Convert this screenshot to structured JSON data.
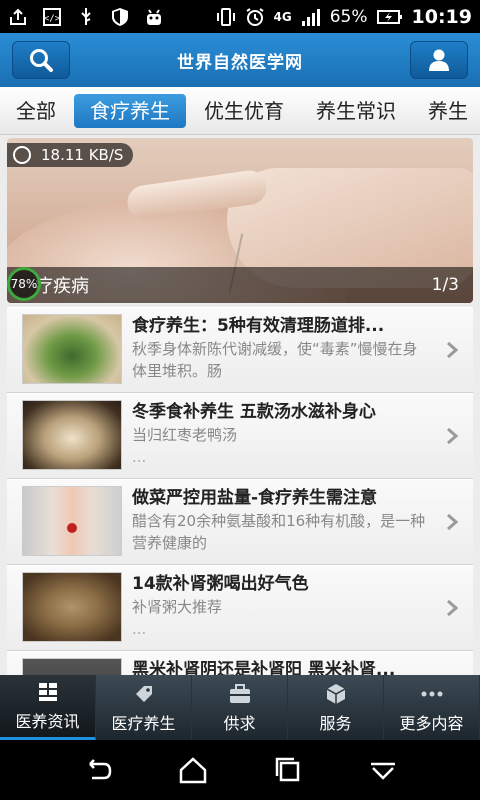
{
  "status_bar": {
    "battery_percent": "65%",
    "time": "10:19",
    "network": "4G"
  },
  "header": {
    "title": "世界自然医学网"
  },
  "tabs": [
    {
      "label": "全部",
      "active": false
    },
    {
      "label": "食疗养生",
      "active": true
    },
    {
      "label": "优生优育",
      "active": false
    },
    {
      "label": "养生常识",
      "active": false
    },
    {
      "label": "养生",
      "active": false
    }
  ],
  "banner": {
    "speed": "18.11 KB/S",
    "progress": "78%",
    "caption": "疗疾病",
    "pager": "1/3"
  },
  "articles": [
    {
      "title": "食疗养生：5种有效清理肠道排...",
      "desc": "秋季身体新陈代谢减缓，使“毒素”慢慢在身体里堆积。肠",
      "desc2": ""
    },
    {
      "title": "冬季食补养生 五款汤水滋补身心",
      "desc": "当归红枣老鸭汤",
      "desc2": "..."
    },
    {
      "title": "做菜严控用盐量-食疗养生需注意",
      "desc": "醋含有20余种氨基酸和16种有机酸，是一种营养健康的",
      "desc2": ""
    },
    {
      "title": "14款补肾粥喝出好气色",
      "desc": "补肾粥大推荐",
      "desc2": "..."
    },
    {
      "title": "黑米补肾阴还是补肾阳 黑米补肾...",
      "desc": "",
      "desc2": ""
    }
  ],
  "bottom_nav": [
    {
      "label": "医养资讯",
      "icon": "grid-icon",
      "active": true
    },
    {
      "label": "医疗养生",
      "icon": "tag-icon",
      "active": false
    },
    {
      "label": "供求",
      "icon": "briefcase-icon",
      "active": false
    },
    {
      "label": "服务",
      "icon": "box-icon",
      "active": false
    },
    {
      "label": "更多内容",
      "icon": "more-icon",
      "active": false
    }
  ],
  "colors": {
    "header_blue": "#1a6fb3",
    "tab_active": "#2b86d0",
    "nav_dark": "#2a343c"
  }
}
